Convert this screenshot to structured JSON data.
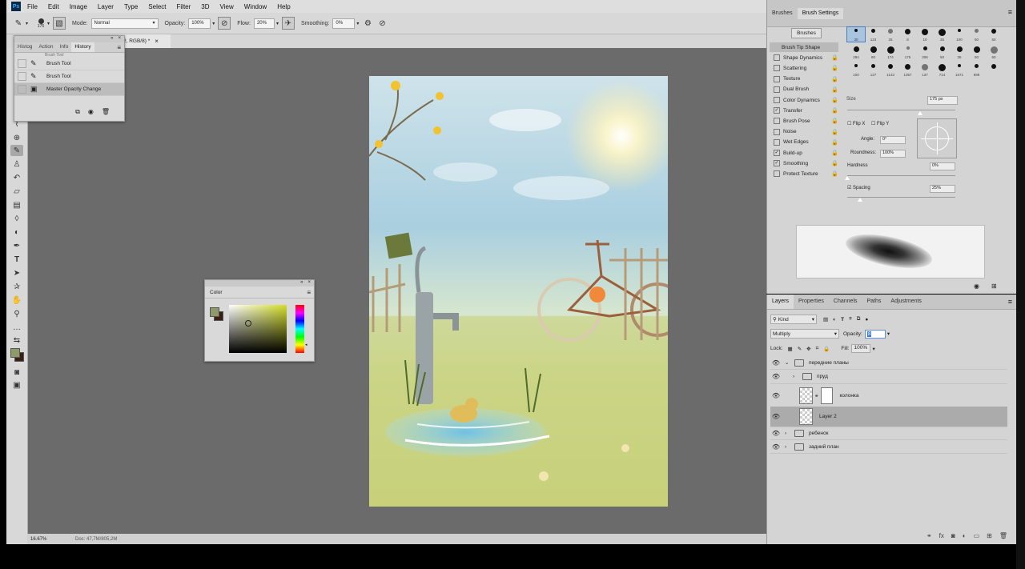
{
  "app": {
    "logo": "Ps"
  },
  "menu": [
    "File",
    "Edit",
    "Image",
    "Layer",
    "Type",
    "Select",
    "Filter",
    "3D",
    "View",
    "Window",
    "Help"
  ],
  "options_bar": {
    "brush_size": "175",
    "mode_label": "Mode:",
    "mode_value": "Normal",
    "opacity_label": "Opacity:",
    "opacity_value": "100%",
    "flow_label": "Flow:",
    "flow_value": "20%",
    "smoothing_label": "Smoothing:",
    "smoothing_value": "0%"
  },
  "document_tab": {
    "label": "2, RGB/8) *",
    "close": "×"
  },
  "history_panel": {
    "tabs": [
      "Histog",
      "Action",
      "Info",
      "History"
    ],
    "active_tab": "History",
    "items": [
      {
        "label": "Brush Tool",
        "selected": false
      },
      {
        "label": "Brush Tool",
        "selected": false
      },
      {
        "label": "Master Opacity Change",
        "selected": true
      }
    ]
  },
  "color_panel": {
    "title": "Color",
    "foreground": "#8e9a6a",
    "background": "#3a1f12",
    "field_color": "#d3de2a"
  },
  "status_bar": {
    "zoom": "16.67%",
    "doc_size": "Doc: 47,7M/805,2M"
  },
  "brush_settings": {
    "tabs": [
      "Brushes",
      "Brush Settings"
    ],
    "active_tab": "Brush Settings",
    "brushes_button": "Brushes",
    "options": [
      {
        "label": "Brush Tip Shape",
        "checkbox": false,
        "checked": false,
        "active": true
      },
      {
        "label": "Shape Dynamics",
        "checkbox": true,
        "checked": false
      },
      {
        "label": "Scattering",
        "checkbox": true,
        "checked": false
      },
      {
        "label": "Texture",
        "checkbox": true,
        "checked": false
      },
      {
        "label": "Dual Brush",
        "checkbox": true,
        "checked": false
      },
      {
        "label": "Color Dynamics",
        "checkbox": true,
        "checked": false
      },
      {
        "label": "Transfer",
        "checkbox": true,
        "checked": true
      },
      {
        "label": "Brush Pose",
        "checkbox": true,
        "checked": false
      },
      {
        "label": "Noise",
        "checkbox": true,
        "checked": false
      },
      {
        "label": "Wet Edges",
        "checkbox": true,
        "checked": false
      },
      {
        "label": "Build-up",
        "checkbox": true,
        "checked": true
      },
      {
        "label": "Smoothing",
        "checkbox": true,
        "checked": true
      },
      {
        "label": "Protect Texture",
        "checkbox": true,
        "checked": false
      }
    ],
    "tip_sizes": [
      "30",
      "123",
      "25",
      "8",
      "10",
      "25",
      "100",
      "50",
      "50",
      "284",
      "80",
      "174",
      "175",
      "306",
      "50",
      "35",
      "50",
      "60",
      "100",
      "127",
      "1143",
      "1357",
      "137",
      "714",
      "1571",
      "699"
    ],
    "size_label": "Size",
    "size_value": "175 px",
    "flip_x": "Flip X",
    "flip_y": "Flip Y",
    "angle_label": "Angle:",
    "angle_value": "0°",
    "roundness_label": "Roundness:",
    "roundness_value": "100%",
    "hardness_label": "Hardness",
    "hardness_value": "0%",
    "spacing_label": "Spacing",
    "spacing_value": "25%"
  },
  "layers_panel": {
    "tabs": [
      "Layers",
      "Properties",
      "Channels",
      "Paths",
      "Adjustments"
    ],
    "active_tab": "Layers",
    "filter_kind": "Kind",
    "blend_mode": "Multiply",
    "opacity_label": "Opacity:",
    "opacity_value": "8",
    "lock_label": "Lock:",
    "fill_label": "Fill:",
    "fill_value": "100%",
    "layers": [
      {
        "name": "передние планы",
        "type": "group",
        "expanded": true,
        "indent": 0
      },
      {
        "name": "пруд",
        "type": "group",
        "expanded": false,
        "indent": 1
      },
      {
        "name": "колонка",
        "type": "layer-mask",
        "indent": 1
      },
      {
        "name": "Layer 2",
        "type": "layer",
        "indent": 1,
        "selected": true
      },
      {
        "name": "ребенок",
        "type": "group",
        "expanded": false,
        "indent": 0
      },
      {
        "name": "задний план",
        "type": "group",
        "expanded": false,
        "indent": 0
      }
    ]
  }
}
